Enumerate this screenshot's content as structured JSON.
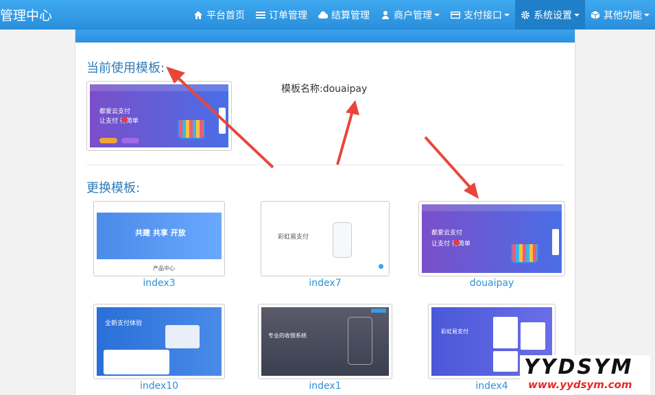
{
  "brand": "管理中心",
  "nav": [
    {
      "label": "平台首页",
      "icon": "home-icon"
    },
    {
      "label": "订单管理",
      "icon": "list-icon"
    },
    {
      "label": "结算管理",
      "icon": "cloud-icon"
    },
    {
      "label": "商户管理",
      "icon": "user-icon",
      "dropdown": true
    },
    {
      "label": "支付接口",
      "icon": "card-icon",
      "dropdown": true
    },
    {
      "label": "系统设置",
      "icon": "gear-icon",
      "dropdown": true,
      "active": true
    },
    {
      "label": "其他功能",
      "icon": "cube-icon",
      "dropdown": true
    }
  ],
  "current": {
    "title": "当前使用模板:",
    "name_label": "模板名称:douaipay",
    "preview": {
      "line1": "都爱云支付",
      "line2": "让支付   得简单"
    }
  },
  "change": {
    "title": "更换模板:",
    "templates": [
      {
        "name": "index3",
        "banner": "共建  共享  开放",
        "sub": "产品中心"
      },
      {
        "name": "index7",
        "heading": "彩虹易支付"
      },
      {
        "name": "douaipay",
        "line1": "都爱云支付",
        "line2": "让支付   得简单"
      },
      {
        "name": "index10",
        "heading": "全新支付体验"
      },
      {
        "name": "index1",
        "heading": "专业的收银系统"
      },
      {
        "name": "index4",
        "heading": "彩虹易支付"
      }
    ]
  },
  "watermark": {
    "big": "YYDSYM",
    "small": "www.yydsym.com"
  },
  "colors": {
    "nav": "#2a8fdc",
    "accent": "#2e8fd6",
    "arrow": "#e8463a"
  }
}
